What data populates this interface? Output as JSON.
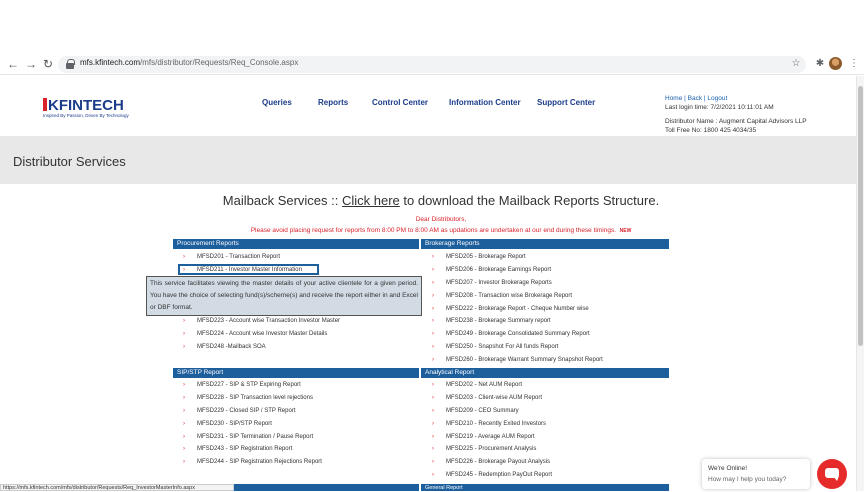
{
  "browser": {
    "url_host": "mfs.kfintech.com",
    "url_path": "/mfs/distributor/Requests/Req_Console.aspx",
    "status_url": "https://mfs.kfintech.com/mfs/distributor/Requests/Req_InvestorMasterInfo.aspx"
  },
  "logo": {
    "text": "FINTECH",
    "tagline": "Inspired By Passion, Driven By Technology"
  },
  "nav": [
    "Queries",
    "Reports",
    "Control Center",
    "Information Center",
    "Support Center"
  ],
  "header_right": {
    "home": "Home",
    "back": "Back",
    "logout": "Logout",
    "sep": " | ",
    "last_login": "Last login time: 7/2/2021 10:11:01 AM",
    "distributor": "Distributor Name : Augment Capital Advisors LLP",
    "toll_free": "Toll Free No: 1800 425 4034/35"
  },
  "banner_title": "Distributor Services",
  "mailback": {
    "prefix": "Mailback Services :: ",
    "link": "Click here",
    "suffix": " to download the Mailback Reports Structure."
  },
  "notice": {
    "line1": "Dear Distributors,",
    "line2": "Please avoid placing request for reports from 8:00 PM to 8:00 AM as updations are undertaken at our end during these timings.",
    "new_badge": "NEW"
  },
  "sections": {
    "procurement": {
      "title": "Procurement Reports",
      "items": [
        "MFSD201 - Transaction Report",
        "MFSD211 - Investor Master Information",
        "MFSD223 - Account wise Transaction Investor Master",
        "MFSD224 - Account wise Investor Master Details",
        "MFSD248 -Mailback SOA"
      ]
    },
    "brokerage": {
      "title": "Brokerage Reports",
      "items": [
        "MFSD205 - Brokerage Report",
        "MFSD206 - Brokerage Earnings Report",
        "MFSD207 - Investor Brokerage Reports",
        "MFSD208 - Transaction wise Brokerage Report",
        "MFSD222 - Brokerage Report - Cheque Number wise",
        "MFSD238 - Brokerage Summary report",
        "MFSD249 - Brokerage Consolidated Summary Report",
        "MFSD250 - Snapshot For All funds Report",
        "MFSD260 - Brokerage Warrant Summary Snapshot Report"
      ]
    },
    "sip": {
      "title": "SIP/STP Report",
      "items": [
        "MFSD227 - SIP & STP Expiring Report",
        "MFSD228 - SIP Transaction level rejections",
        "MFSD229 - Closed SIP / STP Report",
        "MFSD230 - SIP/STP Report",
        "MFSD231 - SIP Termination / Pause Report",
        "MFSD243 - SIP Registration Report",
        "MFSD244 - SIP Registration Rejections Report"
      ]
    },
    "analytical": {
      "title": "Analytical Report",
      "items": [
        "MFSD202 - Net AUM Report",
        "MFSD203 - Client-wise AUM Report",
        "MFSD209 - CEO Summary",
        "MFSD210 - Recently Exited Investors",
        "MFSD219 - Average AUM Report",
        "MFSD225 - Procurement Analysis",
        "MFSD226 - Brokerage Payout Analysis",
        "MFSD245 - Redemption PayOut Report"
      ]
    },
    "general": {
      "title": "General Report"
    }
  },
  "tooltip": "This service facilitates viewing the master details of your active clientele for a given period. You have the choice of selecting fund(s)/scheme(s) and receive the report either in and Excel or DBF format.",
  "chat": {
    "title": "We're Online!",
    "subtitle": "How may I help you today?"
  }
}
